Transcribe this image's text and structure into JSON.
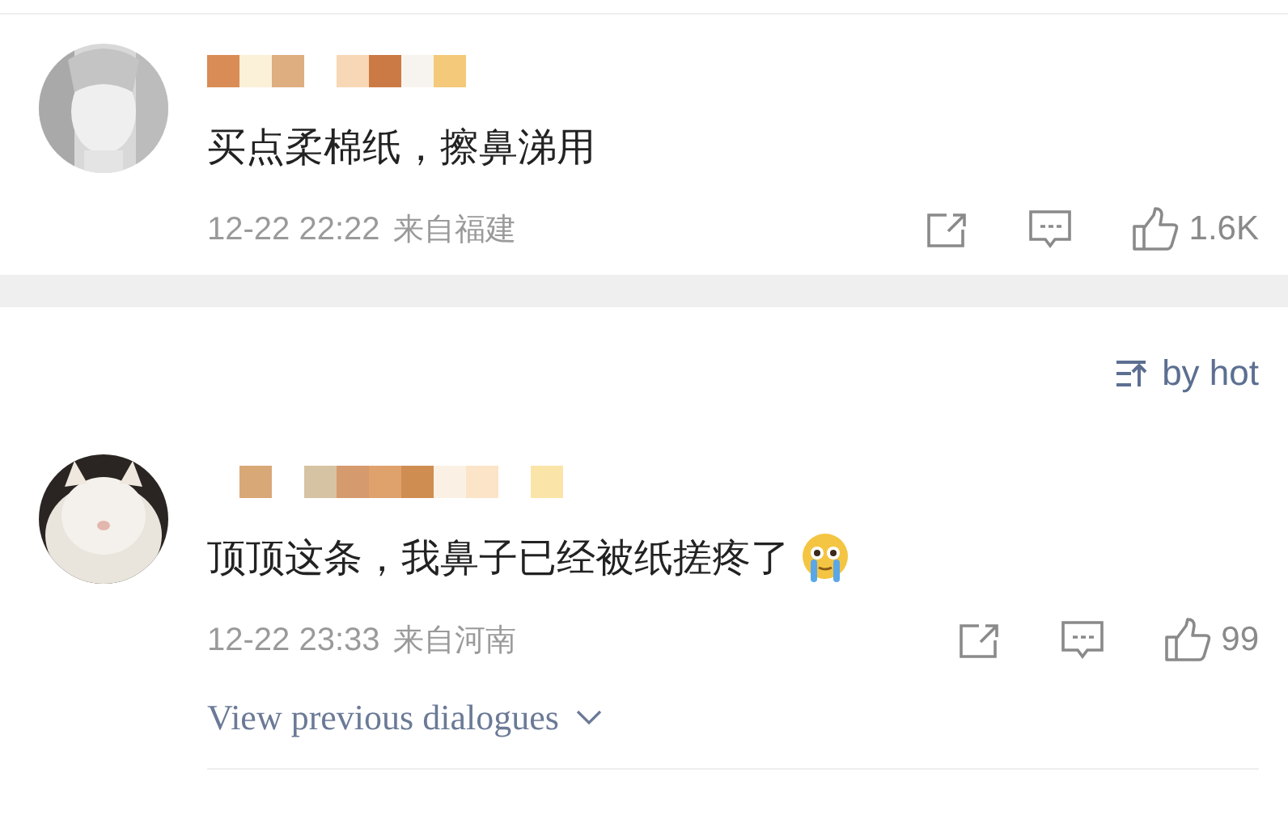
{
  "sections": [
    {
      "comments": [
        {
          "text": "买点柔棉纸，擦鼻涕用",
          "emoji": false,
          "time": "12-22 22:22",
          "location": "来自福建",
          "likes": "1.6K"
        }
      ]
    },
    {
      "sort_label": "by hot",
      "comments": [
        {
          "text": "顶顶这条，我鼻子已经被纸搓疼了",
          "emoji": true,
          "time": "12-22 23:33",
          "location": "来自河南",
          "likes": "99"
        }
      ],
      "view_previous": "View previous dialogues"
    }
  ]
}
